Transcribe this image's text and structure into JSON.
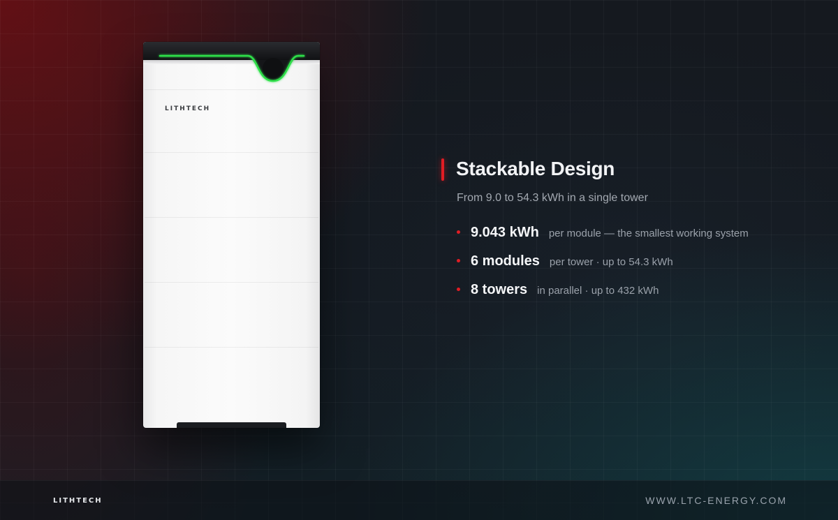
{
  "brand": {
    "device_logo": "LITHTECH",
    "footer_logo": "LITHTECH",
    "website": "WWW.LTC-ENERGY.COM"
  },
  "content": {
    "title": "Stackable Design",
    "subtitle": "From 9.0 to 54.3 kWh in a single tower",
    "specs": [
      {
        "value": "9.043 kWh",
        "desc": "per module — the smallest working system"
      },
      {
        "value": "6 modules",
        "desc": "per tower · up to 54.3 kWh"
      },
      {
        "value": "8 towers",
        "desc": "in parallel · up to 432 kWh"
      }
    ]
  },
  "colors": {
    "accent": "#e11d24",
    "status_light": "#22c33a",
    "background": "#14191f"
  },
  "icons": {
    "bullet": "red-dot-icon"
  }
}
